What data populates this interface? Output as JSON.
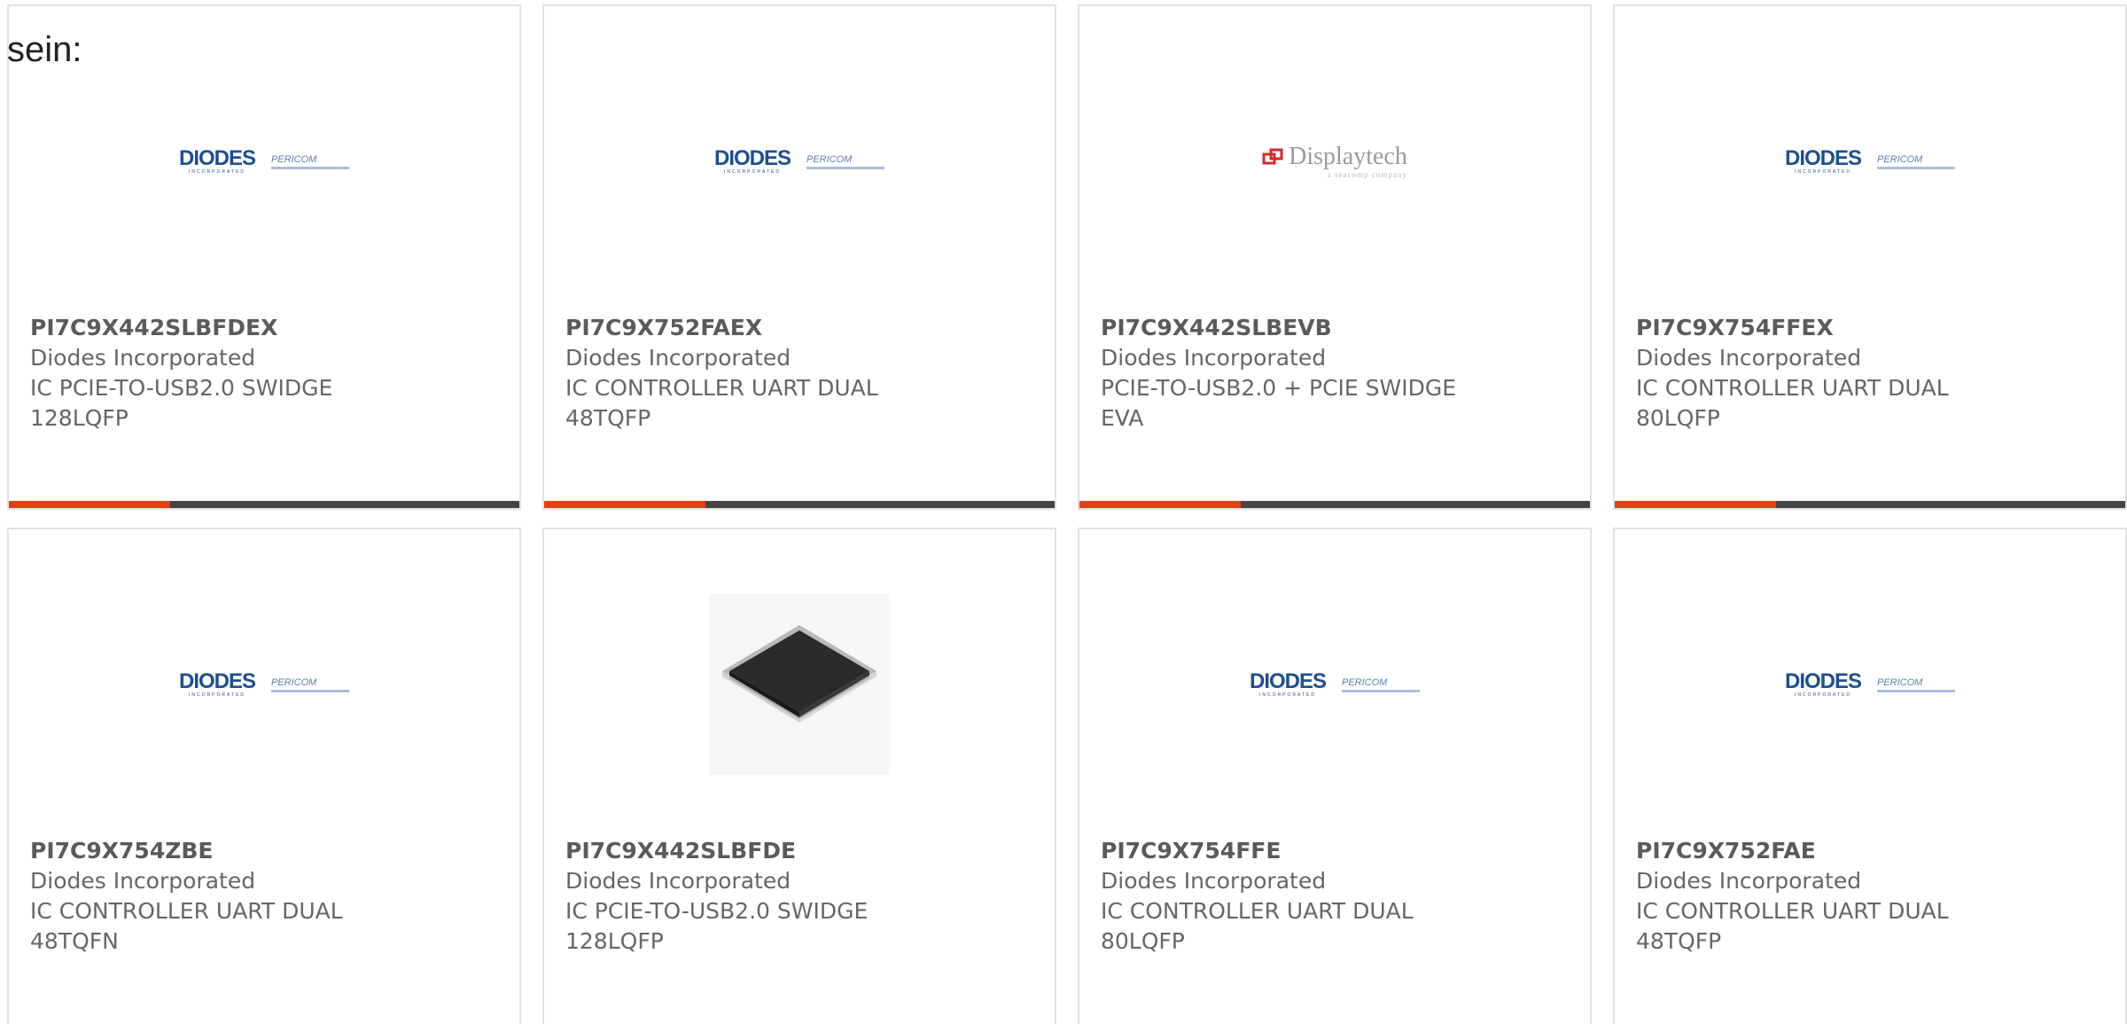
{
  "intro_text": "sein:",
  "colors": {
    "accent": "#e1420f",
    "bar": "#444444",
    "border": "#e1e1e1",
    "diodes_blue": "#1d4f91"
  },
  "brand": {
    "diodes": "DIODES",
    "diodes_sub": "INCORPORATED",
    "pericom": "PERICOM",
    "displaytech": "Displaytech",
    "displaytech_sub": "a seacomp company"
  },
  "products": [
    {
      "part": "PI7C9X442SLBFDEX",
      "manufacturer": "Diodes Incorporated",
      "desc1": "IC PCIE-TO-USB2.0 SWIDGE",
      "desc2": "128LQFP",
      "image": "diodes-pericom-logo"
    },
    {
      "part": "PI7C9X752FAEX",
      "manufacturer": "Diodes Incorporated",
      "desc1": "IC CONTROLLER UART DUAL",
      "desc2": "48TQFP",
      "image": "diodes-pericom-logo"
    },
    {
      "part": "PI7C9X442SLBEVB",
      "manufacturer": "Diodes Incorporated",
      "desc1": "PCIE-TO-USB2.0 + PCIE SWIDGE",
      "desc2": "EVA",
      "image": "displaytech-logo"
    },
    {
      "part": "PI7C9X754FFEX",
      "manufacturer": "Diodes Incorporated",
      "desc1": "IC CONTROLLER UART DUAL",
      "desc2": "80LQFP",
      "image": "diodes-pericom-logo"
    },
    {
      "part": "PI7C9X754ZBE",
      "manufacturer": "Diodes Incorporated",
      "desc1": "IC CONTROLLER UART DUAL",
      "desc2": "48TQFN",
      "image": "diodes-pericom-logo"
    },
    {
      "part": "PI7C9X442SLBFDE",
      "manufacturer": "Diodes Incorporated",
      "desc1": "IC PCIE-TO-USB2.0 SWIDGE",
      "desc2": "128LQFP",
      "image": "lqfp-chip-photo"
    },
    {
      "part": "PI7C9X754FFE",
      "manufacturer": "Diodes Incorporated",
      "desc1": "IC CONTROLLER UART DUAL",
      "desc2": "80LQFP",
      "image": "diodes-pericom-logo"
    },
    {
      "part": "PI7C9X752FAE",
      "manufacturer": "Diodes Incorporated",
      "desc1": "IC CONTROLLER UART DUAL",
      "desc2": "48TQFP",
      "image": "diodes-pericom-logo"
    }
  ]
}
